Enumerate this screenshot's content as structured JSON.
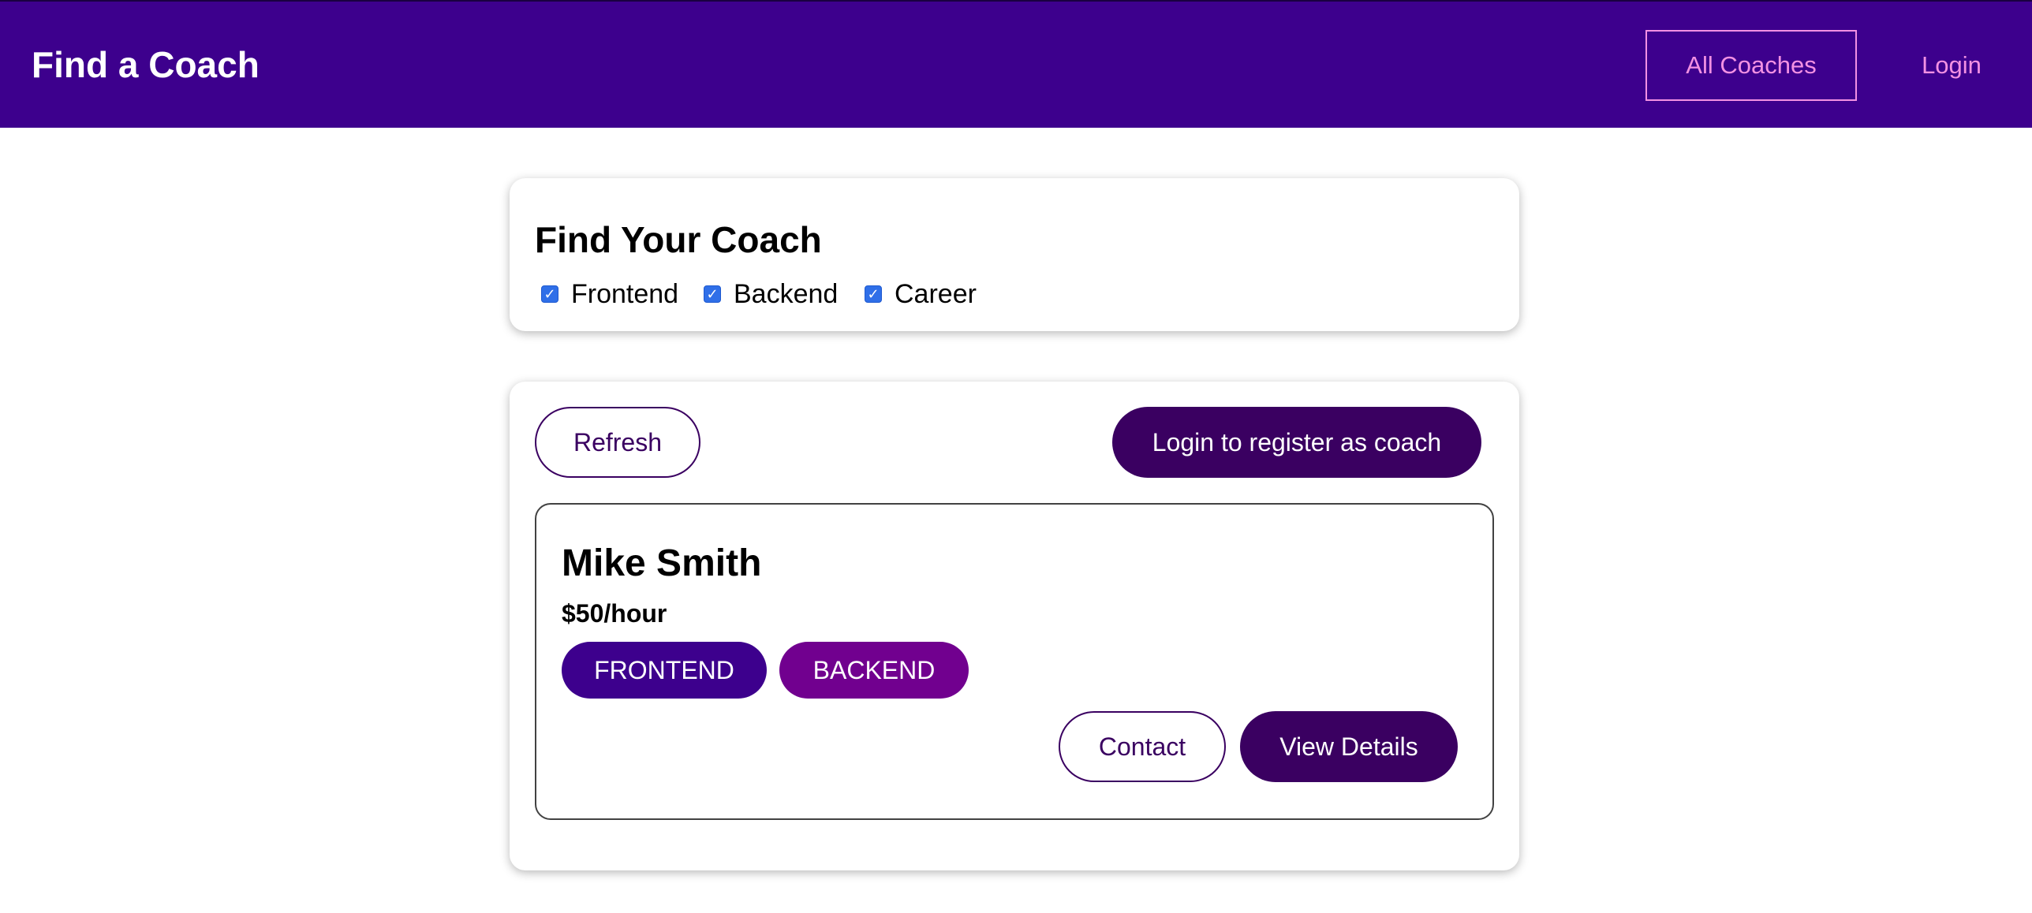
{
  "header": {
    "brand": "Find a Coach",
    "nav": {
      "all_coaches": "All Coaches",
      "login": "Login"
    }
  },
  "filter": {
    "title": "Find Your Coach",
    "options": [
      {
        "label": "Frontend",
        "checked": true
      },
      {
        "label": "Backend",
        "checked": true
      },
      {
        "label": "Career",
        "checked": true
      }
    ]
  },
  "controls": {
    "refresh_label": "Refresh",
    "register_label": "Login to register as coach"
  },
  "coaches": [
    {
      "name": "Mike Smith",
      "rate": "$50/hour",
      "areas": [
        "FRONTEND",
        "BACKEND"
      ],
      "contact_label": "Contact",
      "details_label": "View Details"
    }
  ],
  "colors": {
    "header_bg": "#3d008d",
    "nav_accent": "#f391e3",
    "button_primary": "#3a0061",
    "badge_frontend": "#3d008d",
    "badge_backend": "#71008f",
    "checkbox": "#2f6fe8"
  },
  "icons": {
    "checkbox_checked": "check-icon"
  }
}
